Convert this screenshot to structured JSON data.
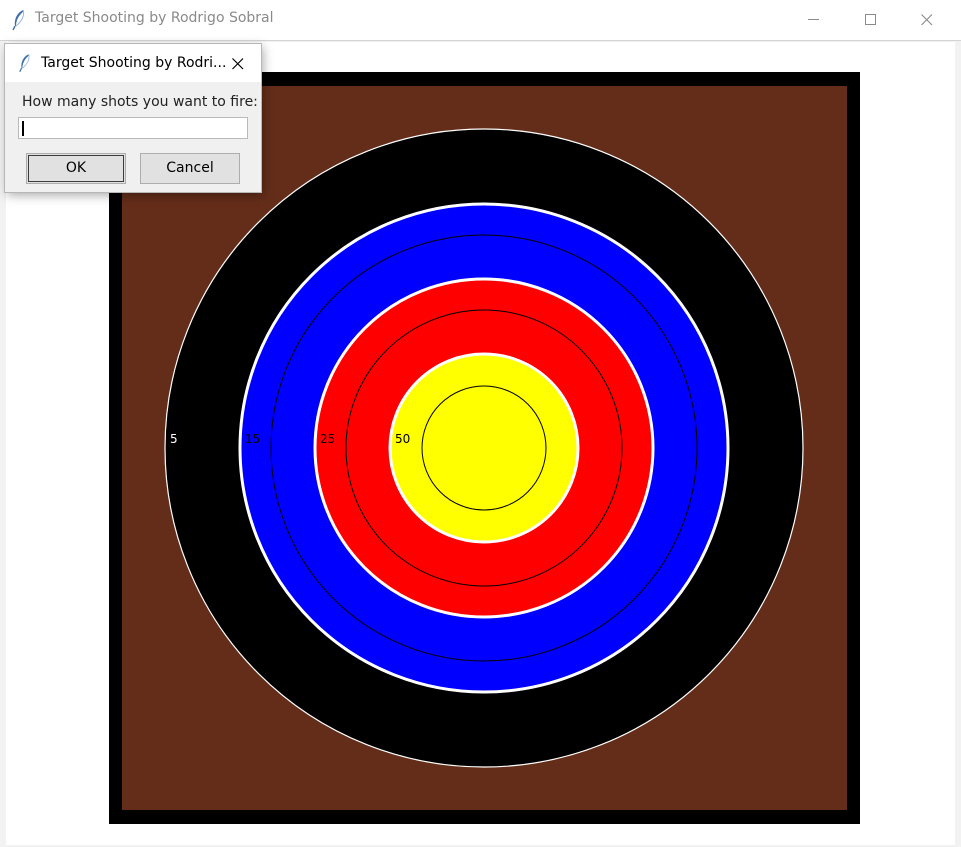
{
  "main_window": {
    "title": "Target Shooting by Rodrigo Sobral",
    "icon": "feather-icon",
    "controls": [
      "minimize-icon",
      "maximize-icon",
      "close-icon"
    ]
  },
  "target": {
    "colors": {
      "frame": "#000000",
      "board": "#632d19",
      "ring_5": "#000000",
      "ring_15": "#0000ff",
      "ring_25": "#ff0000",
      "ring_50": "#ffff00",
      "separator": "#ffffff"
    },
    "ring_labels": [
      "5",
      "15",
      "25",
      "50"
    ]
  },
  "dialog": {
    "title": "Target Shooting by Rodri...",
    "prompt": "How many shots you want to fire:",
    "input_value": "",
    "ok_label": "OK",
    "cancel_label": "Cancel"
  }
}
